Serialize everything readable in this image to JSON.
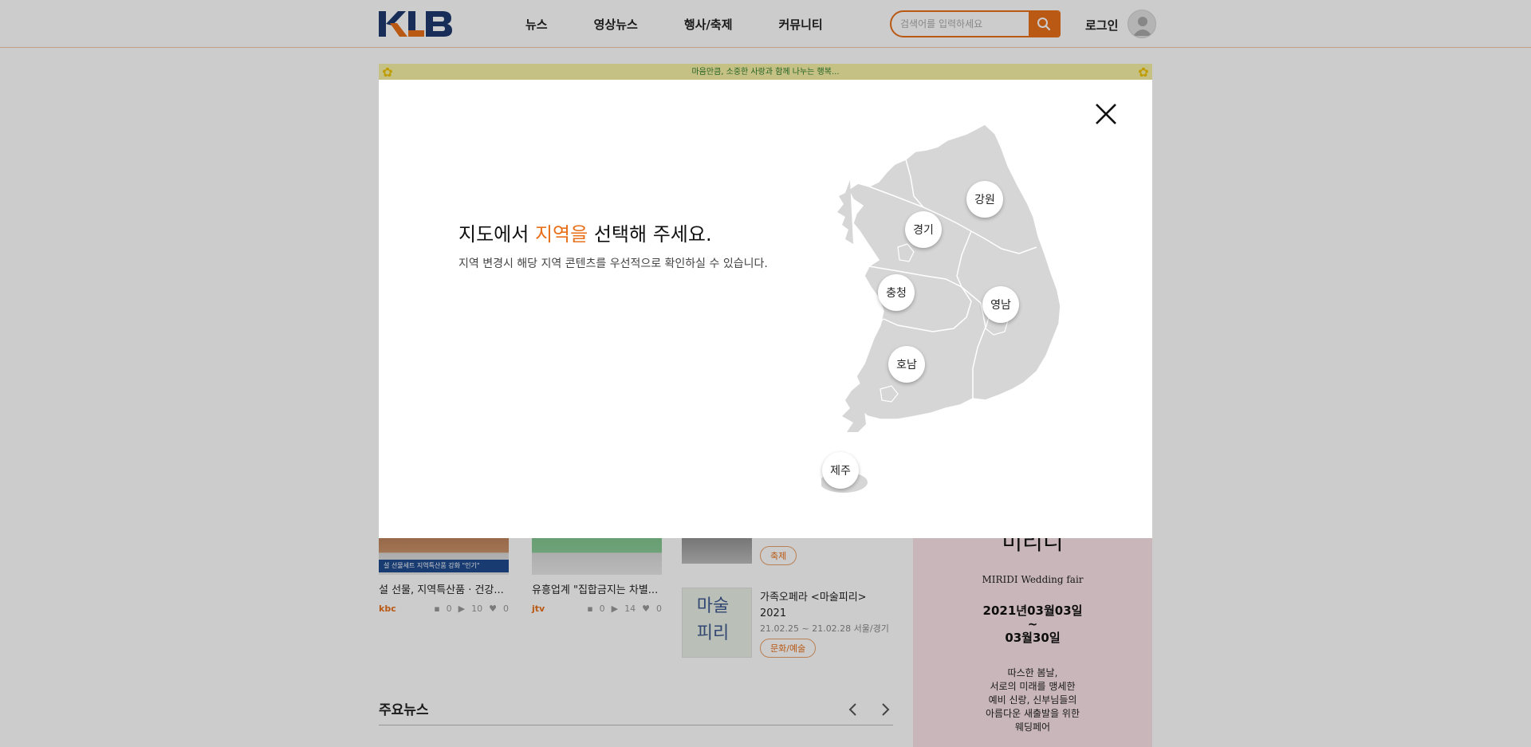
{
  "header": {
    "logo_text": "KLB",
    "nav": [
      "뉴스",
      "영상뉴스",
      "행사/축제",
      "커뮤니티"
    ],
    "search_placeholder": "검색어를 입력하세요",
    "login_label": "로그인"
  },
  "background": {
    "banner_text": "마음만큼, 소중한 사랑과 함께 나누는 행복...",
    "videos": [
      {
        "caption_bar": "설 선물세트 지역특산품 강화 \"인기\"",
        "title": "설 선물, 지역특산품 · 건강...",
        "source": "kbc",
        "comments": "0",
        "views": "10",
        "likes": "0"
      },
      {
        "caption_bar": "",
        "title": "유흥업계 \"집합금지는 차별...",
        "source": "jtv",
        "comments": "0",
        "views": "14",
        "likes": "0"
      }
    ],
    "events": [
      {
        "tag": "축제"
      },
      {
        "title_line1": "가족오페라 <마술피리>",
        "title_line2": "2021",
        "date": "21.02.25 ~ 21.02.28 서울/경기",
        "tag": "문화/예술",
        "thumb_text": "마술 피리"
      }
    ],
    "wedding_ad": {
      "logo": "미리디",
      "en_title": "MIRIDI Wedding fair",
      "date_line1": "2021년03월03일",
      "date_sep": "~",
      "date_line2": "03월30일",
      "desc": [
        "따스한 봄날,",
        "서로의 미래를 맹세한",
        "예비 신랑, 신부님들의",
        "아름다운 새출발을 위한",
        "웨딩페어"
      ]
    },
    "main_news_title": "주요뉴스"
  },
  "modal": {
    "title_before": "지도에서 ",
    "title_highlight": "지역을",
    "title_after": " 선택해 주세요.",
    "subtitle": "지역 변경시 해당 지역 콘텐츠를 우선적으로 확인하실 수 있습니다.",
    "regions": [
      "강원",
      "경기",
      "충청",
      "영남",
      "호남",
      "제주"
    ]
  },
  "colors": {
    "accent": "#e8701a",
    "logo_blue": "#1f3a6e",
    "map_fill": "#d6d6d6"
  }
}
